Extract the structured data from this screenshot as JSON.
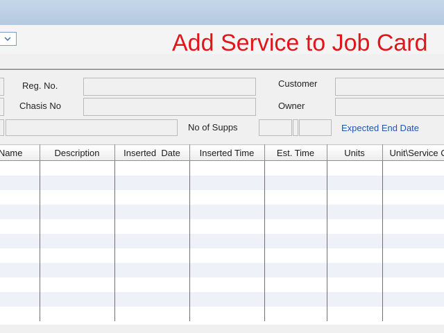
{
  "page": {
    "heading": "Add Service to Job Card"
  },
  "form": {
    "reg_no_label": "Reg. No.",
    "reg_no_value": "",
    "chasis_no_label": "Chasis No",
    "chasis_no_value": "",
    "customer_label": "Customer",
    "customer_value": "",
    "owner_label": "Owner",
    "owner_value": "",
    "no_of_supps_label": "No of Supps",
    "no_of_supps_value": "",
    "expected_end_date_label": "Expected End Date"
  },
  "grid": {
    "columns": [
      "Name",
      "Description",
      "Inserted  Date",
      "Inserted Time",
      "Est. Time",
      "Units",
      "Unit\\Service C"
    ],
    "row_count": 11
  },
  "colors": {
    "heading": "#e0161a",
    "link_label": "#1f56b0",
    "row_alt": "#eef2f8"
  }
}
